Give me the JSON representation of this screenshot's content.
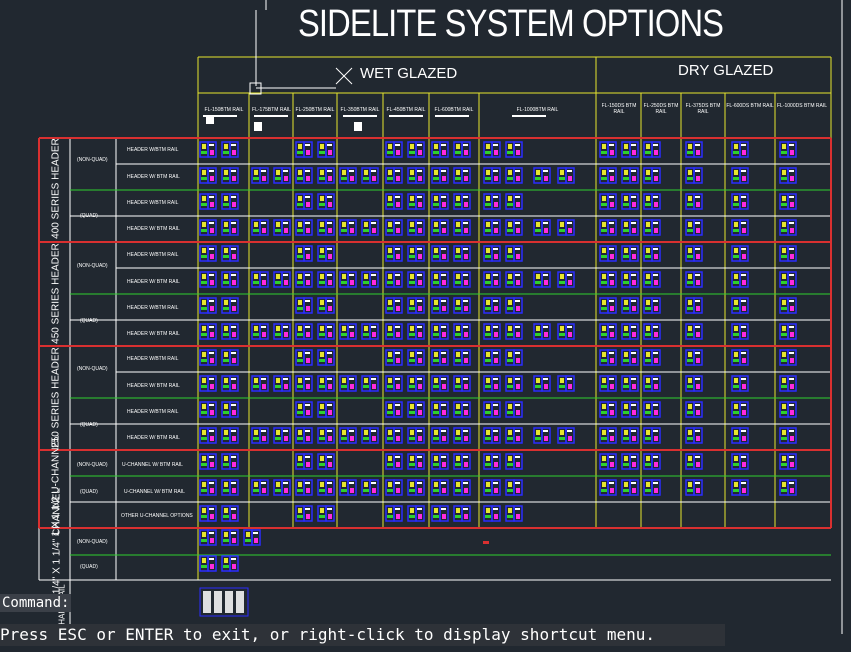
{
  "title": "SIDELITE SYSTEM OPTIONS",
  "groups": {
    "wet": "WET GLAZED",
    "dry": "DRY GLAZED"
  },
  "wet_columns": [
    "FL-150BTM RAIL",
    "FL-175BTM RAIL",
    "FL-250BTM RAIL",
    "FL-350BTM RAIL",
    "FL-450BTM RAIL",
    "FL-600BTM RAIL",
    "FL-1000BTM RAIL"
  ],
  "dry_columns": [
    "FL-150DS BTM RAIL",
    "FL-250DS BTM RAIL",
    "FL-375DS BTM RAIL",
    "FL-600DS BTM RAIL",
    "FL-1000DS BTM RAIL"
  ],
  "sections": [
    {
      "name": "400 SERIES HEADER"
    },
    {
      "name": "450 SERIES HEADER"
    },
    {
      "name": "250 SERIES HEADER"
    },
    {
      "name": "1 X 1 1/2 U-CHANNEL"
    },
    {
      "name": "1 1/4\" X 1 1/4\" CHANNEL"
    },
    {
      "name": "HANDRAIL"
    }
  ],
  "glazing": {
    "non_quad": "(NON-QUAD)",
    "quad": "(QUAD)"
  },
  "rows": {
    "header_wo": "HEADER W/BTM RAIL",
    "header_w": "HEADER W/ BTM RAIL",
    "uch_wo": "U-CHANNEL W/ BTM RAIL",
    "uch_w": "U-CHANNEL W/ BTM RAIL",
    "uch_other": "OTHER U-CHANNEL OPTIONS"
  },
  "command": {
    "label": "Command:",
    "message": "Press ESC or ENTER to exit, or right-click to display shortcut menu."
  },
  "colors": {
    "background": "#212830",
    "yellow": "#e6e62e",
    "red": "#d93030",
    "green": "#2ed12e",
    "white": "#ffffff",
    "blue": "#2a2cff",
    "magenta": "#ff2adf"
  }
}
